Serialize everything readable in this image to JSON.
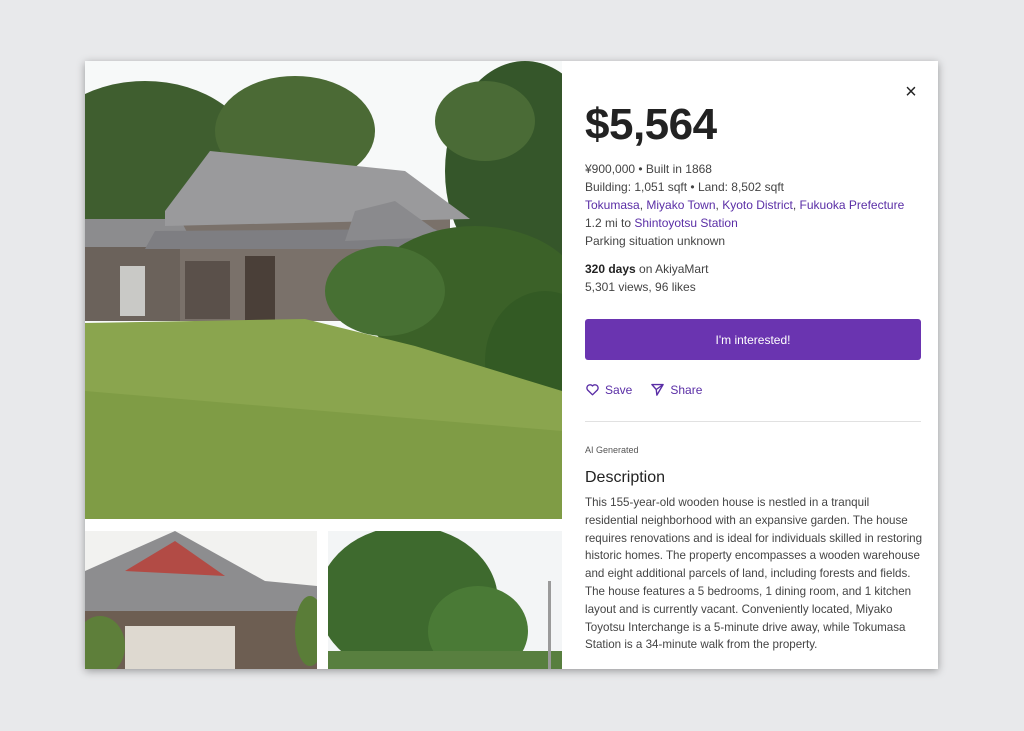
{
  "listing": {
    "price": "$5,564",
    "yen_and_year": "¥900,000 • Built in 1868",
    "size": "Building: 1,051 sqft • Land: 8,502 sqft",
    "location": [
      "Tokumasa",
      "Miyako Town",
      "Kyoto District",
      "Fukuoka Prefecture"
    ],
    "location_sep": ", ",
    "station_prefix": "1.2 mi to ",
    "station_name": "Shintoyotsu Station",
    "parking": "Parking situation unknown",
    "days_bold": "320 days",
    "days_suffix": " on AkiyaMart",
    "views_likes": "5,301 views, 96 likes"
  },
  "buttons": {
    "interested": "I'm interested!",
    "save": "Save",
    "share": "Share",
    "close": "×"
  },
  "description": {
    "ai_tag": "AI Generated",
    "title": "Description",
    "body": "This 155-year-old wooden house is nestled in a tranquil residential neighborhood with an expansive garden. The house requires renovations and is ideal for individuals skilled in restoring historic homes. The property encompasses a wooden warehouse and eight additional parcels of land, including forests and fields. The house features a 5 bedrooms, 1 dining room, and 1 kitchen layout and is currently vacant. Conveniently located, Miyako Toyotsu Interchange is a 5-minute drive away, while Tokumasa Station is a 34-minute walk from the property."
  },
  "icons": {
    "close": "close-icon",
    "save": "heart-icon",
    "share": "send-icon"
  },
  "colors": {
    "accent": "#6a34b0",
    "link": "#5a2ea6",
    "background": "#e8e9eb"
  }
}
